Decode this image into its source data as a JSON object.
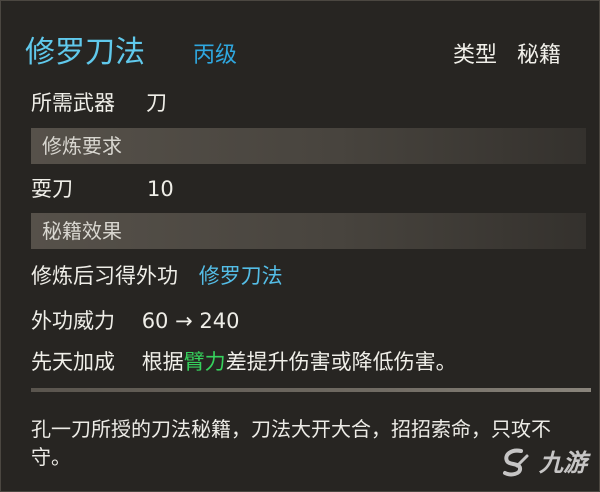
{
  "header": {
    "name": "修罗刀法",
    "grade": "丙级",
    "type_label": "类型",
    "type_value": "秘籍"
  },
  "weapon": {
    "label": "所需武器",
    "value": "刀"
  },
  "sections": {
    "requirements": "修炼要求",
    "effects": "秘籍效果"
  },
  "requirement": {
    "label": "耍刀",
    "value": "10"
  },
  "learn": {
    "label": "修炼后习得外功",
    "value": "修罗刀法"
  },
  "power": {
    "label": "外功威力",
    "value": "60 → 240"
  },
  "innate": {
    "label": "先天加成",
    "prefix": "根据",
    "attribute": "臂力",
    "suffix": "差提升伤害或降低伤害。"
  },
  "description": "孔一刀所授的刀法秘籍，刀法大开大合，招招索命，只攻不守。",
  "watermark": {
    "text": "九游",
    "icon": "jiuyou-logo-icon"
  },
  "colors": {
    "title": "#60c9ec",
    "grade": "#2fa7df",
    "attribute": "#36d15c"
  }
}
